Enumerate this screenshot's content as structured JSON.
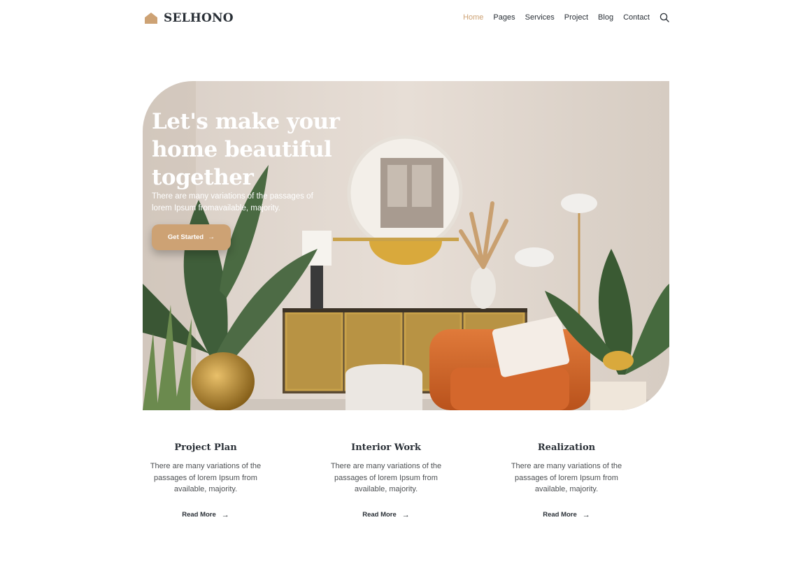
{
  "brand": {
    "name": "SELHONO",
    "icon": "house-icon",
    "accent": "#cda274"
  },
  "nav": {
    "items": [
      "Home",
      "Pages",
      "Services",
      "Project",
      "Blog",
      "Contact"
    ],
    "active": "Home",
    "search_icon": "search-icon"
  },
  "hero": {
    "title": "Let's make your home beautiful together",
    "subtitle": "There are many variations of the passages of lorem Ipsum fromavailable, majority.",
    "button_label": "Get Started",
    "button_icon": "arrow-right-icon"
  },
  "features": [
    {
      "title": "Project Plan",
      "text": "There are many variations of the passages of lorem Ipsum from available, majority.",
      "link": "Read More"
    },
    {
      "title": "Interior Work",
      "text": "There are many variations of the passages of lorem Ipsum from available, majority.",
      "link": "Read More"
    },
    {
      "title": "Realization",
      "text": "There are many variations of the passages of lorem Ipsum from available, majority.",
      "link": "Read More"
    }
  ]
}
